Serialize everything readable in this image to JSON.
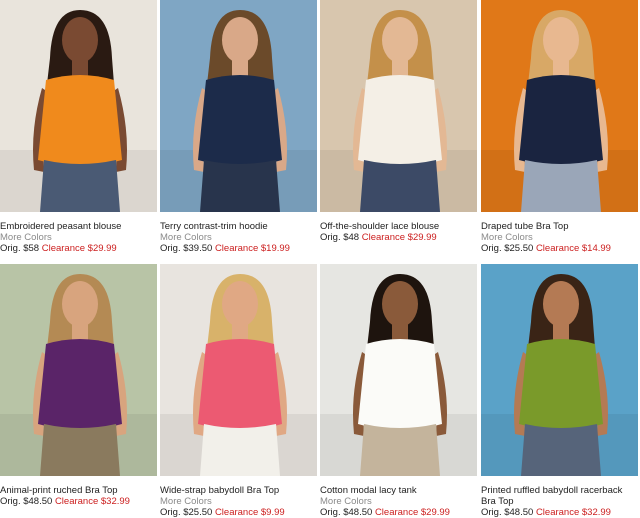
{
  "products": [
    {
      "name": "Embroidered peasant blouse",
      "more_colors": "More Colors",
      "orig_label": "Orig. $58",
      "clearance": "Clearance $29.99",
      "image": "model-orange-peasant-blouse",
      "bg": "#e9e4dc",
      "top": "#f08a1c",
      "skin": "#7a4a32",
      "hair": "#2a1a12",
      "bottom": "#4a5a74"
    },
    {
      "name": "Terry contrast-trim hoodie",
      "more_colors": "More Colors",
      "orig_label": "Orig. $39.50",
      "clearance": "Clearance $19.99",
      "image": "model-navy-hoodie-beach",
      "bg": "#7fa6c4",
      "top": "#1c2b4a",
      "skin": "#d9a888",
      "hair": "#6b4a2a",
      "bottom": "#28344c"
    },
    {
      "name": "Off-the-shoulder lace blouse",
      "more_colors": "",
      "orig_label": "Orig. $48",
      "clearance": "Clearance $29.99",
      "image": "model-lace-blouse-hat",
      "bg": "#d8c6ae",
      "top": "#f4efe6",
      "skin": "#e3b894",
      "hair": "#c4904a",
      "bottom": "#3c4a66"
    },
    {
      "name": "Draped tube Bra Top",
      "more_colors": "More Colors",
      "orig_label": "Orig. $25.50",
      "clearance": "Clearance $14.99",
      "image": "model-navy-tube-top",
      "bg": "#e07818",
      "top": "#1a2440",
      "skin": "#e8b890",
      "hair": "#d8a866",
      "bottom": "#9aa6b8"
    },
    {
      "name": "Animal-print ruched Bra Top",
      "more_colors": "",
      "orig_label": "Orig. $48.50",
      "clearance": "Clearance $32.99",
      "image": "model-purple-animal-print-top",
      "bg": "#b8c4a6",
      "top": "#5a2468",
      "skin": "#d8a47e",
      "hair": "#b48a54",
      "bottom": "#8a7a5e"
    },
    {
      "name": "Wide-strap babydoll Bra Top",
      "more_colors": "More Colors",
      "orig_label": "Orig. $25.50",
      "clearance": "Clearance $9.99",
      "image": "model-pink-babydoll-top",
      "bg": "#e8e4df",
      "top": "#ec5a72",
      "skin": "#e0a884",
      "hair": "#d8b26a",
      "bottom": "#f2f0ea"
    },
    {
      "name": "Cotton modal lacy tank",
      "more_colors": "More Colors",
      "orig_label": "Orig. $48.50",
      "clearance": "Clearance $29.99",
      "image": "model-white-lacy-tank",
      "bg": "#e6e6e2",
      "top": "#fbfbf8",
      "skin": "#8a5a3a",
      "hair": "#1e140e",
      "bottom": "#c4b49c"
    },
    {
      "name": "Printed ruffled babydoll racerback Bra Top",
      "more_colors": "",
      "orig_label": "Orig. $48.50",
      "clearance": "Clearance $32.99",
      "image": "model-green-ruffled-top-beach",
      "bg": "#5aa2c8",
      "top": "#7a9a2a",
      "skin": "#b47a54",
      "hair": "#3a2416",
      "bottom": "#56647a"
    }
  ]
}
